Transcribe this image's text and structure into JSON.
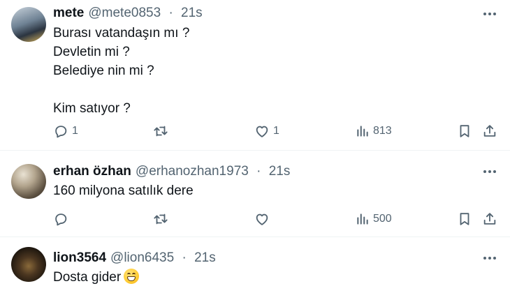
{
  "tweets": [
    {
      "display_name": "mete",
      "handle": "@mete0853",
      "separator": "·",
      "time": "21s",
      "lines": [
        "Burası vatandaşın mı ?",
        "Devletin mi ?",
        "Belediye nin mi ?",
        "",
        "Kim satıyor ?"
      ],
      "replies": "1",
      "retweets": "",
      "likes": "1",
      "views": "813"
    },
    {
      "display_name": "erhan özhan",
      "handle": "@erhanozhan1973",
      "separator": "·",
      "time": "21s",
      "lines": [
        "160 milyona satılık dere"
      ],
      "replies": "",
      "retweets": "",
      "likes": "",
      "views": "500"
    },
    {
      "display_name": "lion3564",
      "handle": "@lion6435",
      "separator": "·",
      "time": "21s",
      "text": "Dosta gider",
      "emoji": "grinning-face-with-smiling-eyes"
    }
  ],
  "icons": {
    "more": "more-horizontal-icon",
    "reply": "reply-icon",
    "retweet": "retweet-icon",
    "like": "heart-icon",
    "views": "views-chart-icon",
    "bookmark": "bookmark-icon",
    "share": "share-icon"
  },
  "colors": {
    "text_primary": "#0f1419",
    "text_secondary": "#536471",
    "divider": "#eff3f4",
    "background": "#ffffff"
  }
}
